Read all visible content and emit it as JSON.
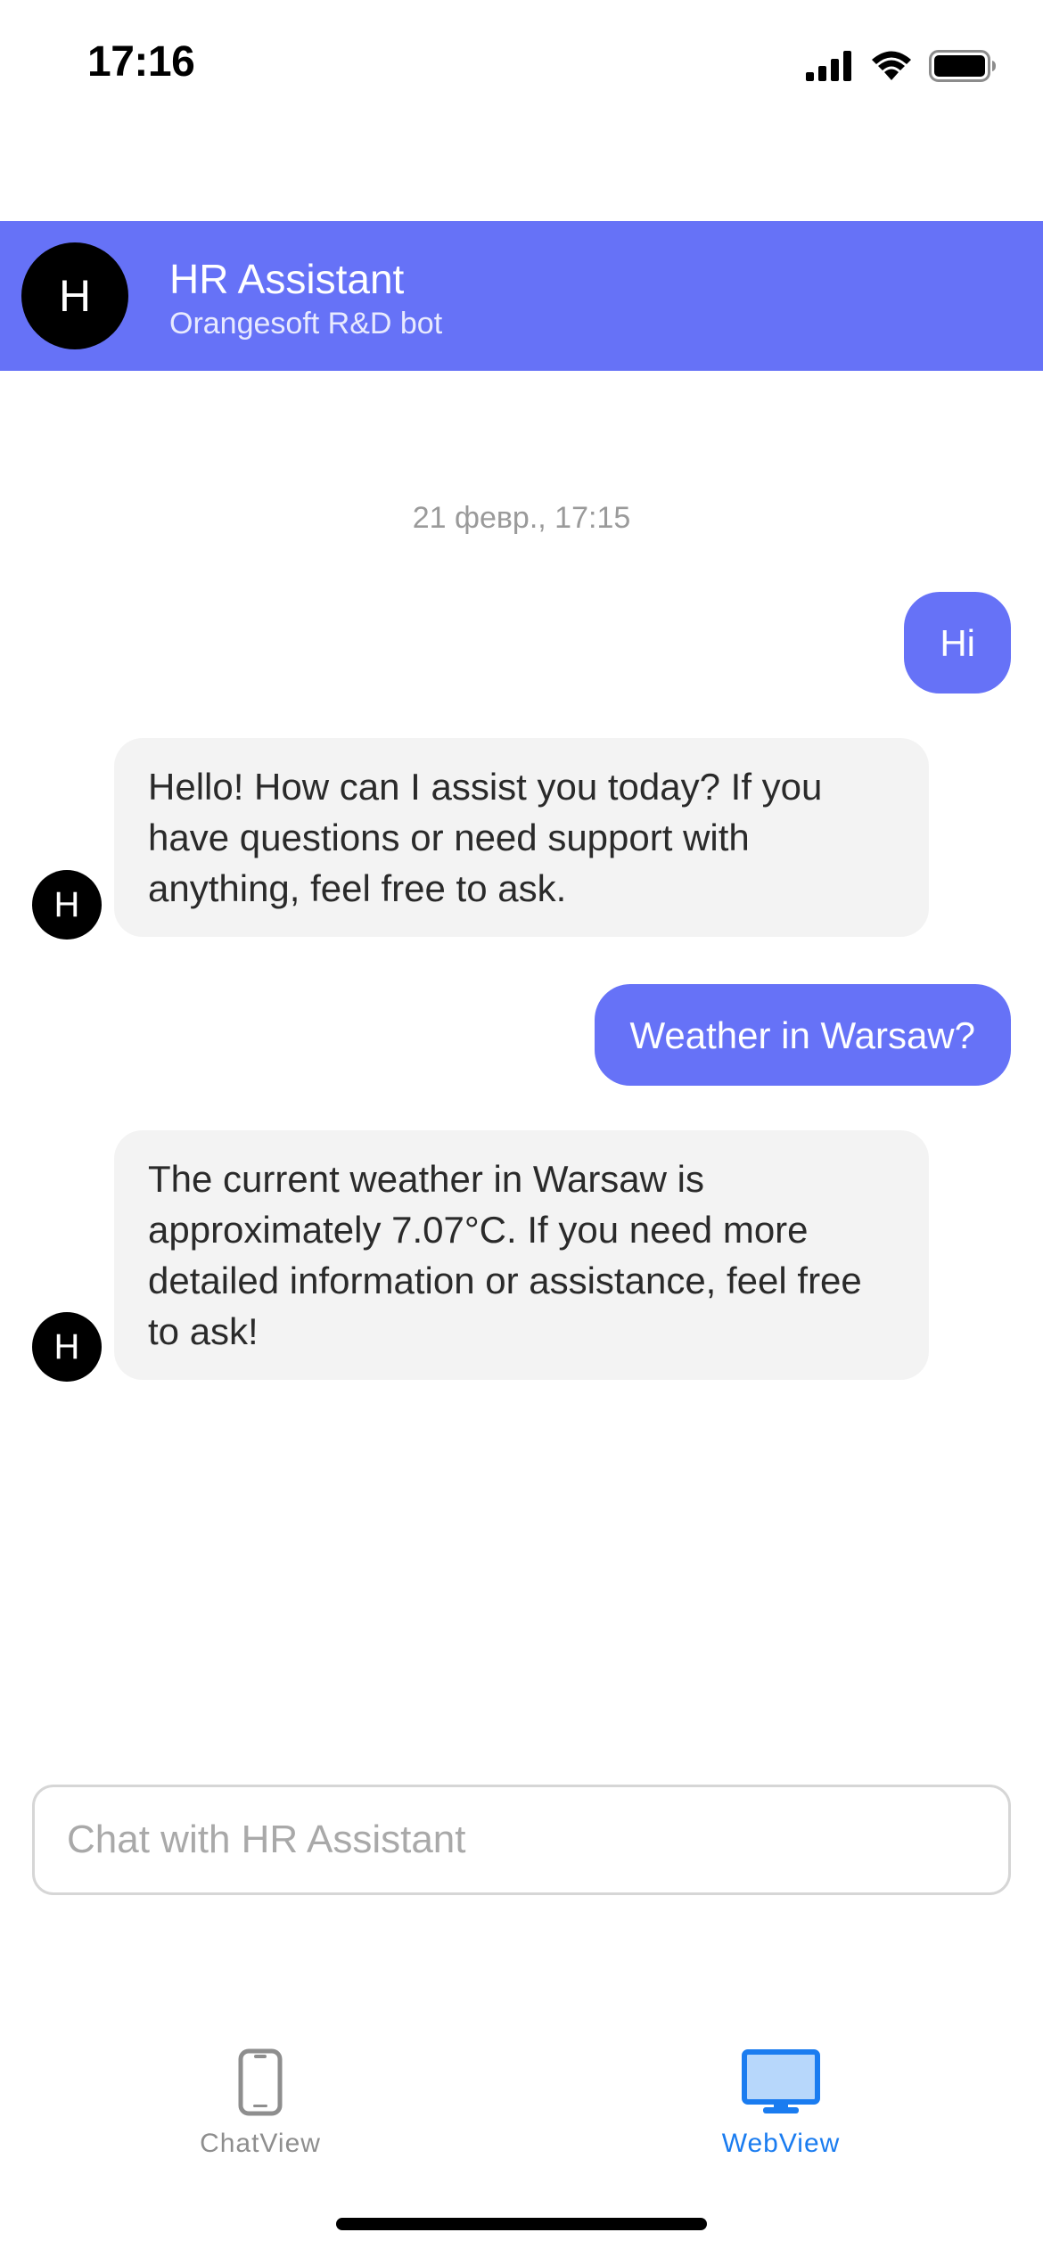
{
  "status_bar": {
    "time": "17:16",
    "icons": [
      "signal-icon",
      "wifi-icon",
      "battery-icon"
    ]
  },
  "header": {
    "avatar_initial": "H",
    "title": "HR Assistant",
    "subtitle": "Orangesoft R&D bot",
    "background_color": "#6672f7"
  },
  "chat": {
    "date_stamp": "21 февр., 17:15",
    "messages": [
      {
        "sender": "user",
        "text": "Hi"
      },
      {
        "sender": "bot",
        "avatar_initial": "H",
        "text": "Hello! How can I assist you today? If you have questions or need support with anything, feel free to ask."
      },
      {
        "sender": "user",
        "text": "Weather in Warsaw?"
      },
      {
        "sender": "bot",
        "avatar_initial": "H",
        "text": "The current weather in Warsaw is approximately 7.07°C. If you need more detailed information or assistance, feel free to ask!"
      }
    ]
  },
  "input": {
    "placeholder": "Chat with HR Assistant",
    "value": ""
  },
  "tab_bar": {
    "tabs": [
      {
        "label": "ChatView",
        "icon": "phone-icon",
        "active": false
      },
      {
        "label": "WebView",
        "icon": "monitor-icon",
        "active": true
      }
    ],
    "active_color": "#1a7cf0",
    "inactive_color": "#8e8e8e"
  }
}
